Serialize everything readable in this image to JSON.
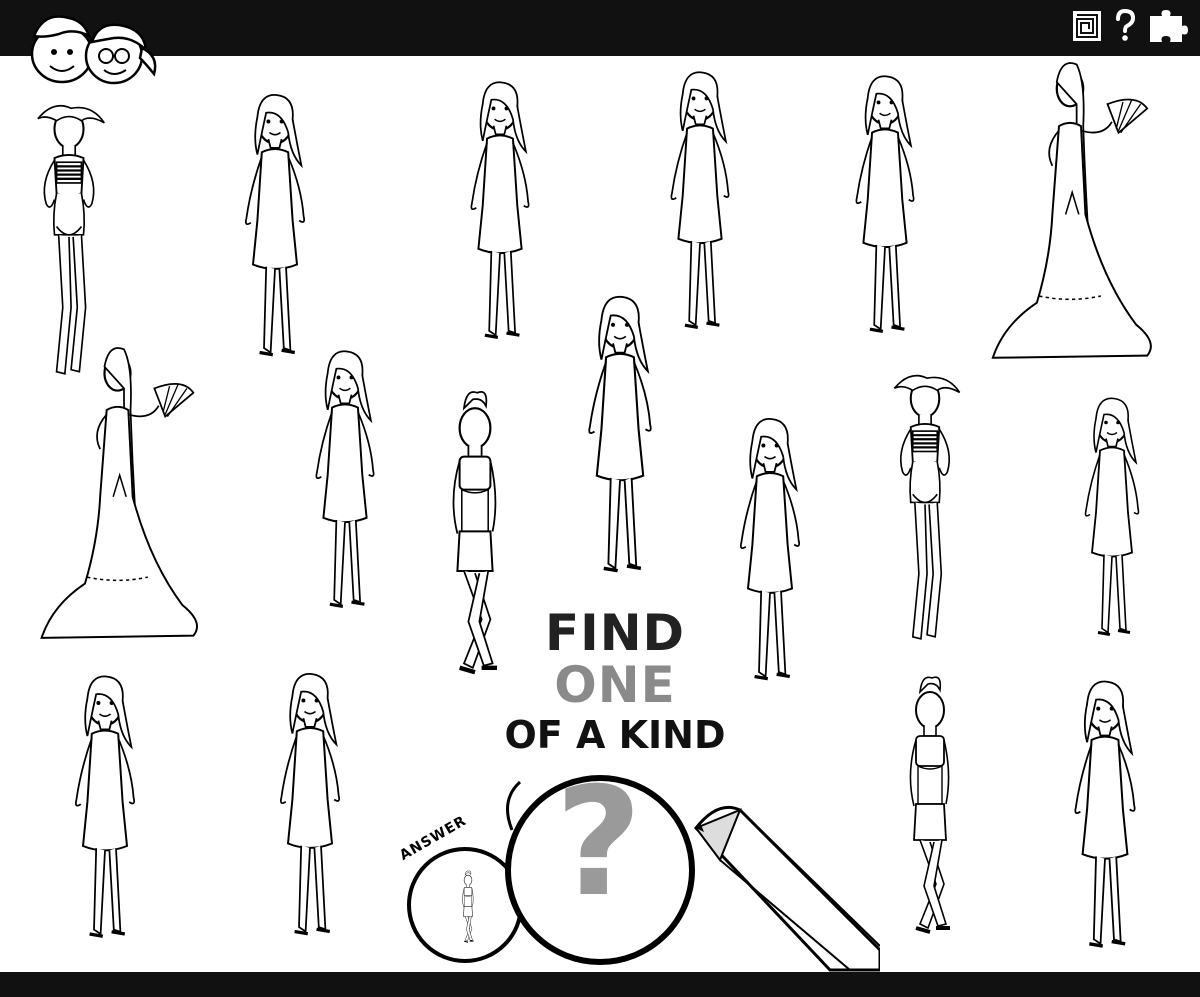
{
  "puzzle": {
    "title_line1": "FIND",
    "title_line2": "ONE",
    "title_line3": "OF A KIND",
    "answer_label": "ANSWER",
    "question_mark": "?"
  },
  "toolbar": {
    "icons": [
      "maze-icon",
      "question-icon",
      "puzzle-piece-icon"
    ]
  },
  "colors": {
    "bar": "#111111",
    "one_gray": "#8a8a8a",
    "background": "#ffffff"
  }
}
